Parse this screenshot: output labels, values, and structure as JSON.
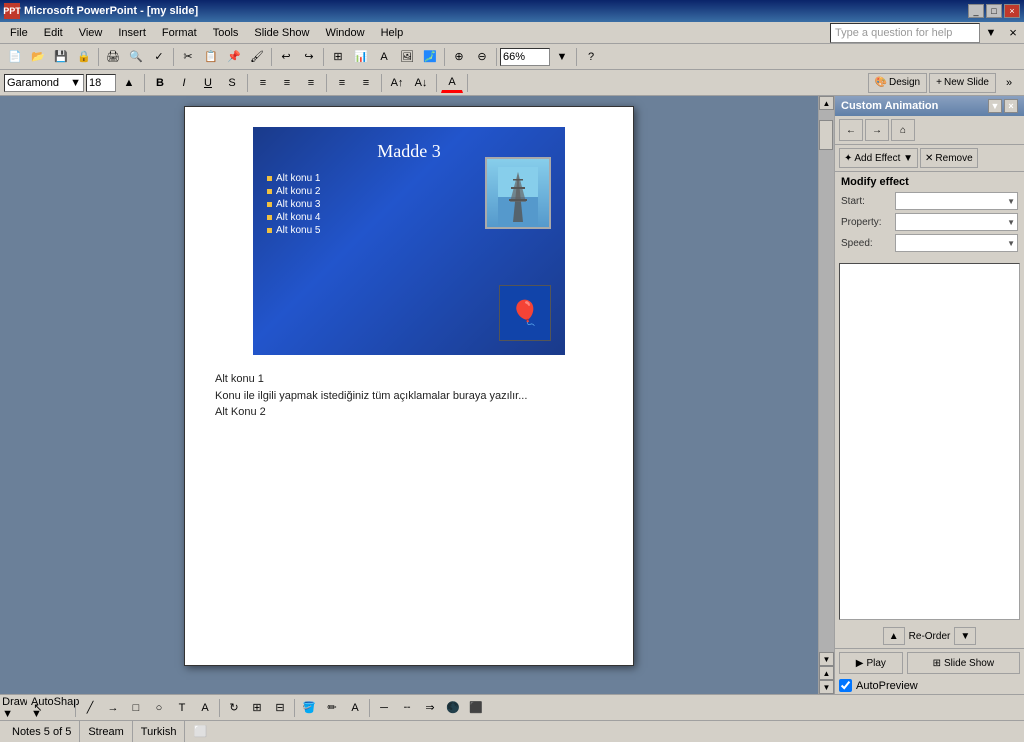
{
  "titlebar": {
    "title": "Microsoft PowerPoint - [my slide]",
    "logo": "PPT",
    "controls": [
      "_",
      "□",
      "×"
    ]
  },
  "menubar": {
    "items": [
      "File",
      "Edit",
      "View",
      "Insert",
      "Format",
      "Tools",
      "Slide Show",
      "Window",
      "Help"
    ]
  },
  "toolbar": {
    "zoom": "66%",
    "help_placeholder": "Type a question for help"
  },
  "formatbar": {
    "font": "Garamond",
    "size": "18",
    "bold": "B",
    "italic": "I",
    "underline": "U",
    "shadow": "S",
    "design_label": "Design",
    "new_slide_label": "New Slide"
  },
  "slide": {
    "title": "Madde 3",
    "bullets": [
      "Alt konu 1",
      "Alt konu 2",
      "Alt konu 3",
      "Alt konu 4",
      "Alt konu 5"
    ]
  },
  "notes": {
    "line1": "Alt konu 1",
    "line2": "Konu ile ilgili yapmak istediğiniz tüm açıklamalar buraya yazılır...",
    "line3": "Alt Konu 2"
  },
  "custom_animation": {
    "title": "Custom Animation",
    "modify_effect_label": "Modify effect",
    "start_label": "Start:",
    "property_label": "Property:",
    "speed_label": "Speed:",
    "reorder_label": "Re-Order",
    "play_label": "Play",
    "slide_show_label": "Slide Show",
    "autopreview_label": "AutoPreview",
    "nav_buttons": [
      "←",
      "→",
      "⌂"
    ]
  },
  "statusbar": {
    "notes": "Notes 5 of 5",
    "stream": "Stream",
    "language": "Turkish"
  },
  "drawbar": {
    "draw_label": "Draw ▼",
    "autoshapes_label": "AutoShapes ▼"
  }
}
